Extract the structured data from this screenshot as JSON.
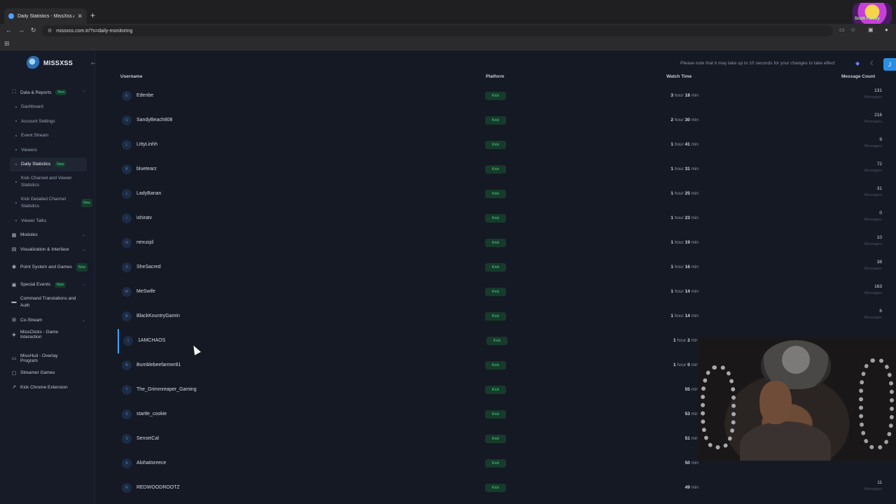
{
  "browser": {
    "tab_title": "Daily Statistics - MissXss AI Bot",
    "url": "missxss.com.tr/?s=daily-monitoring",
    "corner_logo_text": "Scott Family"
  },
  "app": {
    "brand": "MISSXSS",
    "notice": "Please note that it may take up to 10 seconds for your changes to take effect",
    "user_initial": "J"
  },
  "sidebar": {
    "items": [
      {
        "type": "sect",
        "icon": "⛶",
        "label": "Data & Reports",
        "badge": "New",
        "chev": "⌃"
      },
      {
        "type": "sub",
        "label": "Dashboard"
      },
      {
        "type": "sub",
        "label": "Account Settings"
      },
      {
        "type": "sub",
        "label": "Event Stream"
      },
      {
        "type": "sub",
        "label": "Viewers"
      },
      {
        "type": "sub",
        "label": "Daily Statistics",
        "badge": "New",
        "active": true
      },
      {
        "type": "sub",
        "label": "Kick Channel and Viewer Statistics",
        "two": true
      },
      {
        "type": "sub",
        "label": "Kick Detailed Channel Statistics",
        "badge": "New",
        "two": true
      },
      {
        "type": "sub",
        "label": "Viewer Talks"
      },
      {
        "type": "sect",
        "icon": "▦",
        "label": "Modules",
        "chev": "⌄"
      },
      {
        "type": "sect",
        "icon": "▤",
        "label": "Visualization & Interface",
        "chev": "⌄"
      },
      {
        "type": "sect",
        "icon": "◉",
        "label": "Point System and Games",
        "badge": "New",
        "chev": "⌄",
        "two": true
      },
      {
        "type": "sect",
        "icon": "▣",
        "label": "Special Events",
        "badge": "New",
        "chev": "⌄"
      },
      {
        "type": "sect",
        "icon": "▬",
        "label": "Command Translations and Auth",
        "two": true
      },
      {
        "type": "sect",
        "icon": "⊞",
        "label": "Co-Stream",
        "chev": "⌄"
      },
      {
        "type": "sect",
        "icon": "◈",
        "label": "MissClicks - Game Interaction"
      },
      {
        "type": "gap"
      },
      {
        "type": "sect",
        "icon": "▭",
        "label": "MissHud - Overlay Program"
      },
      {
        "type": "sect",
        "icon": "▢",
        "label": "Streamer Games"
      },
      {
        "type": "sect",
        "icon": "↗",
        "label": "Kick Chrome Extension"
      }
    ]
  },
  "table": {
    "headers": {
      "username": "Username",
      "platform": "Platform",
      "watch_time": "Watch Time",
      "message_count": "Message Count"
    },
    "message_label": "Messages",
    "rows": [
      {
        "initial": "E",
        "username": "Edenbe",
        "platform": "Kick",
        "h": "3",
        "hu": "hour",
        "m": "18",
        "mu": "min",
        "count": "131"
      },
      {
        "initial": "S",
        "username": "SandyBeach808",
        "platform": "Kick",
        "h": "2",
        "hu": "hour",
        "m": "30",
        "mu": "min",
        "count": "216"
      },
      {
        "initial": "L",
        "username": "LittyLinhh",
        "platform": "Kick",
        "h": "1",
        "hu": "hour",
        "m": "41",
        "mu": "min",
        "count": "9"
      },
      {
        "initial": "B",
        "username": "bluetearz",
        "platform": "Kick",
        "h": "1",
        "hu": "hour",
        "m": "31",
        "mu": "min",
        "count": "72"
      },
      {
        "initial": "L",
        "username": "LadyBanan",
        "platform": "Kick",
        "h": "1",
        "hu": "hour",
        "m": "25",
        "mu": "min",
        "count": "31"
      },
      {
        "initial": "I",
        "username": "ishiratv",
        "platform": "Kick",
        "h": "1",
        "hu": "hour",
        "m": "23",
        "mu": "min",
        "count": "0"
      },
      {
        "initial": "N",
        "username": "nexusjd",
        "platform": "Kick",
        "h": "1",
        "hu": "hour",
        "m": "19",
        "mu": "min",
        "count": "10"
      },
      {
        "initial": "S",
        "username": "SheSacred",
        "platform": "Kick",
        "h": "1",
        "hu": "hour",
        "m": "16",
        "mu": "min",
        "count": "38"
      },
      {
        "initial": "M",
        "username": "MeSwife",
        "platform": "Kick",
        "h": "1",
        "hu": "hour",
        "m": "14",
        "mu": "min",
        "count": "163"
      },
      {
        "initial": "B",
        "username": "BlackKountryGamin",
        "platform": "Kick",
        "h": "1",
        "hu": "hour",
        "m": "14",
        "mu": "min",
        "count": "6"
      },
      {
        "initial": "1",
        "username": "1AMCHAOS",
        "platform": "Kick",
        "h": "1",
        "hu": "hour",
        "m": "2",
        "mu": "min",
        "count": "",
        "selected": true
      },
      {
        "initial": "B",
        "username": "Bumblebeefarmer81",
        "platform": "Kick",
        "h": "1",
        "hu": "hour",
        "m": "0",
        "mu": "min",
        "count": ""
      },
      {
        "initial": "T",
        "username": "The_Grimmreaper_Gaming",
        "platform": "Kick",
        "h": "",
        "hu": "",
        "m": "55",
        "mu": "min",
        "count": ""
      },
      {
        "initial": "S",
        "username": "startle_cookie",
        "platform": "Kick",
        "h": "",
        "hu": "",
        "m": "53",
        "mu": "min",
        "count": ""
      },
      {
        "initial": "S",
        "username": "SenseiCal",
        "platform": "Kick",
        "h": "",
        "hu": "",
        "m": "51",
        "mu": "min",
        "count": ""
      },
      {
        "initial": "A",
        "username": "Alohaitsreece",
        "platform": "Kick",
        "h": "",
        "hu": "",
        "m": "50",
        "mu": "min",
        "count": ""
      },
      {
        "initial": "R",
        "username": "REDWOODROOTZ",
        "platform": "Kick",
        "h": "",
        "hu": "",
        "m": "49",
        "mu": "min",
        "count": "11"
      }
    ]
  }
}
